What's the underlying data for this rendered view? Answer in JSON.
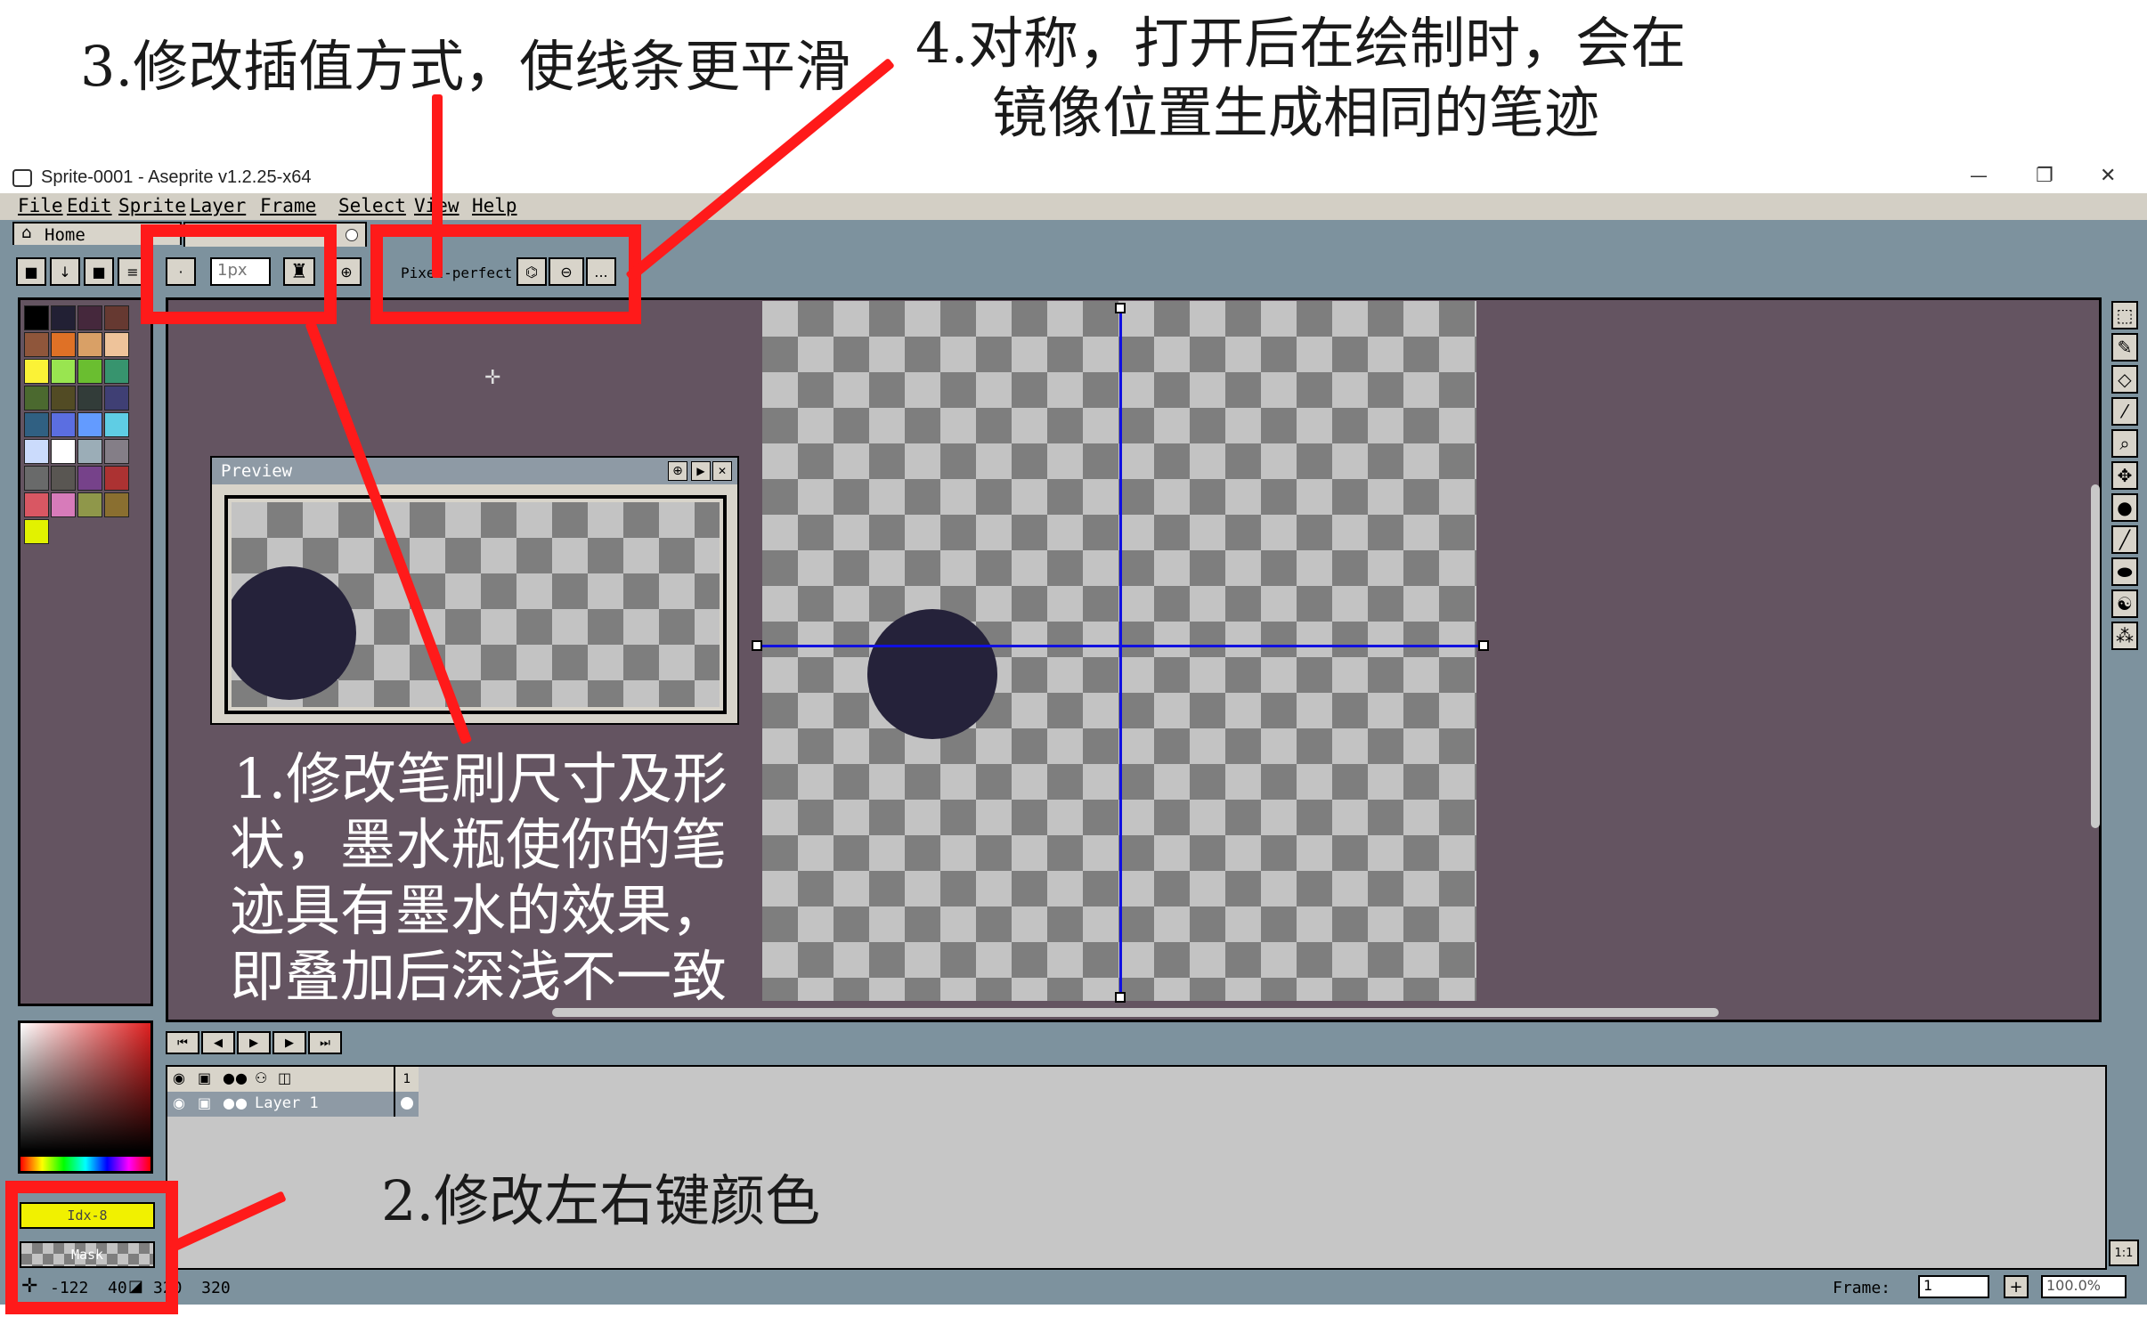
{
  "annotations": {
    "a1_lines": [
      "1.修改笔刷尺寸及形",
      "状，墨水瓶使你的笔",
      "迹具有墨水的效果，",
      "即叠加后深浅不一致"
    ],
    "a2": "2.修改左右键颜色",
    "a3": "3.修改插值方式，使线条更平滑",
    "a4_line1": "4.对称，打开后在绘制时，会在",
    "a4_line2": "镜像位置生成相同的笔迹",
    "color": "#ff1a1a"
  },
  "window": {
    "title": "Sprite-0001 - Aseprite v1.2.25-x64",
    "minimize": "—",
    "restore": "❐",
    "close": "✕"
  },
  "menu": [
    "File",
    "Edit",
    "Sprite",
    "Layer",
    "Frame",
    "Select",
    "View",
    "Help"
  ],
  "tabs": {
    "home": "Home"
  },
  "toolbar": {
    "brush_size": "1px",
    "pixel_perfect": "Pixel-perfect",
    "more": "..."
  },
  "preview": {
    "title": "Preview"
  },
  "colors": {
    "fg_label": "Idx-8",
    "bg_label": "Mask",
    "fg_color": "#f1f100",
    "accent_red": "#ff1a1a",
    "sprite_circle": "#25223a",
    "symmetry_line": "#1010e0",
    "editor_bg": "#645461",
    "ui_bg": "#7d929e",
    "palette": [
      "#000000",
      "#222034",
      "#45283c",
      "#663931",
      "#8f563b",
      "#df7126",
      "#d9a066",
      "#eec39a",
      "#fbf236",
      "#99e550",
      "#6abe30",
      "#37946e",
      "#4b692f",
      "#524b24",
      "#323c39",
      "#3f3f74",
      "#306082",
      "#5b6ee1",
      "#639bff",
      "#5fcde4",
      "#cbdbfc",
      "#ffffff",
      "#9badb7",
      "#847e87",
      "#696a6a",
      "#595652",
      "#76428a",
      "#ac3232",
      "#d95763",
      "#d77bba",
      "#8f974a",
      "#8a6f30",
      "#e2f200"
    ]
  },
  "timeline": {
    "frame_number": "1",
    "layer_name": "Layer 1"
  },
  "statusbar": {
    "cursor": "-122  40",
    "size": "320  320",
    "frame_label": "Frame:",
    "frame_value": "1",
    "zoom": "100.0%",
    "one_to_one": "1:1"
  }
}
